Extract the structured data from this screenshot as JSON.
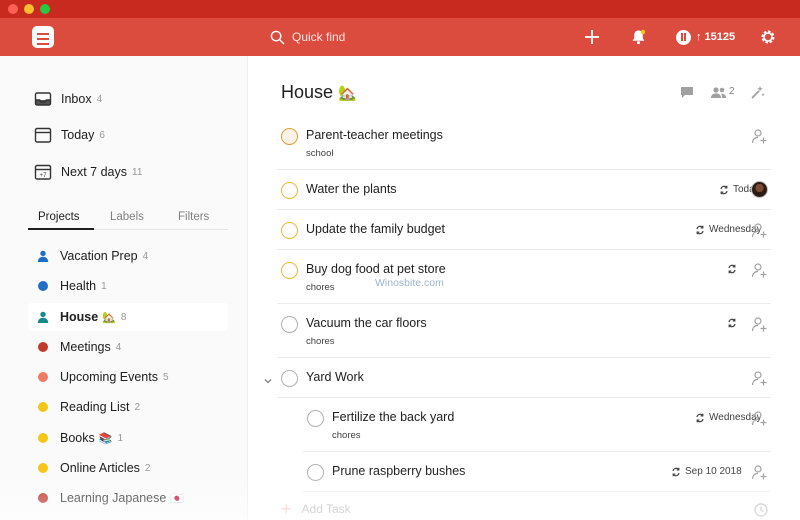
{
  "colors": {
    "titlebar": "#c92a1f",
    "header": "#db4c3f",
    "priority1": "#e69a3b",
    "priority2": "#f2b632"
  },
  "header": {
    "search_placeholder": "Quick find",
    "karma": "↑ 15125",
    "icons": [
      "todoist-logo-icon",
      "search-icon",
      "plus-icon",
      "bell-icon",
      "karma-icon",
      "gear-icon"
    ]
  },
  "sidebar": {
    "nav": [
      {
        "label": "Inbox",
        "count": "4",
        "icon": "inbox-icon"
      },
      {
        "label": "Today",
        "count": "6",
        "icon": "calendar-today-icon"
      },
      {
        "label": "Next 7 days",
        "count": "11",
        "icon": "calendar-week-icon"
      }
    ],
    "tabs": [
      "Projects",
      "Labels",
      "Filters"
    ],
    "active_tab": "Projects",
    "projects": [
      {
        "label": "Vacation Prep",
        "count": "4",
        "color": "#1f6fc5",
        "shared": true,
        "emoji": ""
      },
      {
        "label": "Health",
        "count": "1",
        "color": "#1f6fc5",
        "shared": false,
        "emoji": ""
      },
      {
        "label": "House",
        "count": "8",
        "color": "#168a8a",
        "shared": true,
        "emoji": "🏡",
        "selected": true
      },
      {
        "label": "Meetings",
        "count": "4",
        "color": "#c0392b",
        "shared": false,
        "emoji": ""
      },
      {
        "label": "Upcoming Events",
        "count": "5",
        "color": "#f07a66",
        "shared": false,
        "emoji": ""
      },
      {
        "label": "Reading List",
        "count": "2",
        "color": "#f5c518",
        "shared": false,
        "emoji": ""
      },
      {
        "label": "Books",
        "count": "1",
        "color": "#f5c518",
        "shared": false,
        "emoji": "📚"
      },
      {
        "label": "Online Articles",
        "count": "2",
        "color": "#f5c518",
        "shared": false,
        "emoji": ""
      },
      {
        "label": "Learning Japanese",
        "count": "",
        "color": "#b8251a",
        "shared": false,
        "emoji": "🇯🇵"
      }
    ]
  },
  "main": {
    "title": "House",
    "title_emoji": "🏡",
    "members_count": "2",
    "tasks": [
      {
        "name": "Parent-teacher meetings",
        "label": "school",
        "due": "",
        "priority": "p1",
        "assignee": "add"
      },
      {
        "name": "Water the plants",
        "label": "",
        "due": "Today",
        "priority": "p2",
        "assignee": "avatar"
      },
      {
        "name": "Update the family budget",
        "label": "",
        "due": "Wednesday",
        "priority": "p2",
        "assignee": "add"
      },
      {
        "name": "Buy dog food at pet store",
        "label": "chores",
        "due": "",
        "priority": "p2",
        "assignee": "add"
      },
      {
        "name": "Vacuum the car floors",
        "label": "chores",
        "due": "",
        "priority": "none",
        "assignee": "add"
      },
      {
        "name": "Yard Work",
        "label": "",
        "due": "",
        "priority": "none",
        "assignee": "add"
      },
      {
        "name": "Fertilize the back yard",
        "label": "chores",
        "due": "Wednesday",
        "priority": "none",
        "assignee": "add"
      },
      {
        "name": "Prune raspberry bushes",
        "label": "",
        "due": "Sep 10 2018",
        "priority": "none",
        "assignee": "add"
      }
    ],
    "watermark": "Winosbite.com",
    "add_task": "Add Task"
  }
}
